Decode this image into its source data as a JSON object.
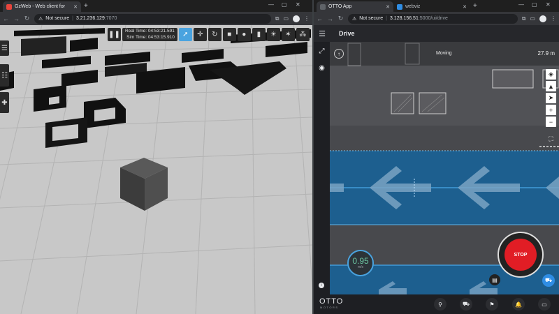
{
  "left_browser": {
    "tabs": [
      {
        "title": "GzWeb - Web client for",
        "active": true,
        "favicon_color": "#e8453c"
      }
    ],
    "address": {
      "security": "Not secure",
      "host": "3.21.236.129",
      "port": ":7070"
    }
  },
  "right_browser": {
    "tabs": [
      {
        "title": "OTTO App",
        "active": true,
        "favicon_color": "#5f6368"
      },
      {
        "title": "webviz",
        "active": false,
        "favicon_color": "#2f8de4"
      }
    ],
    "address": {
      "security": "Not secure",
      "host": "3.128.156.51",
      "path": ":5000/ui/drive"
    }
  },
  "gzweb": {
    "toolbar": {
      "pause_icon": "pause-icon",
      "real_time_label": "Real Time: 04:53:21.591",
      "sim_time_label": "Sim Time: 04:53:15.910",
      "tools": [
        "select-arrow-icon",
        "translate-icon",
        "rotate-icon",
        "box-icon",
        "sphere-icon",
        "cylinder-icon",
        "sun-icon",
        "spotlight-icon",
        "directional-light-icon"
      ]
    },
    "side_buttons": [
      "menu-icon",
      "tree-icon",
      "plus-icon"
    ]
  },
  "otto": {
    "header": {
      "title": "Drive"
    },
    "status": {
      "state": "Moving",
      "distance": "27.9 m"
    },
    "speed": {
      "value": "0.95",
      "unit": "m/s"
    },
    "stop_label": "STOP",
    "brand": {
      "name": "OTTO",
      "sub": "MOTORS"
    },
    "map_controls": [
      "layers-icon",
      "robot-icon",
      "locate-icon",
      "zoom-in-icon",
      "zoom-out-icon",
      "camera-icon"
    ],
    "footer_icons": [
      "joystick-icon",
      "robot-icon",
      "location-icon",
      "alert-icon",
      "battery-icon"
    ],
    "colors": {
      "accent": "#2f8de4",
      "stop": "#e11d25",
      "lane": "#1d5f8f",
      "header": "#26272b"
    }
  }
}
